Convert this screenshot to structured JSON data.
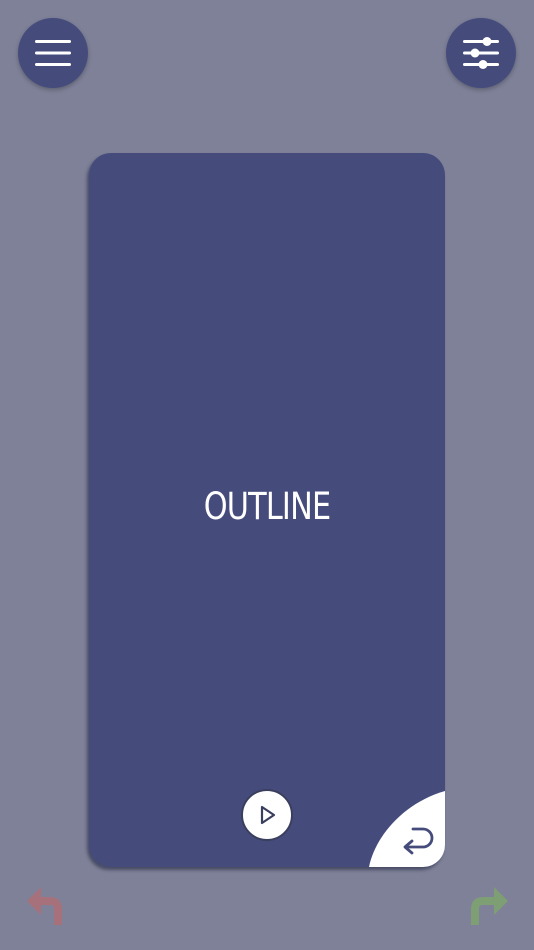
{
  "card": {
    "word": "OUTLINE"
  },
  "icons": {
    "menu": "hamburger-menu-icon",
    "filter": "sliders-icon",
    "play": "play-icon",
    "flip": "return-arrow-icon",
    "undo": "undo-arrow-icon",
    "redo": "redo-arrow-icon"
  },
  "colors": {
    "background": "#7e8198",
    "card": "#454c7c",
    "undo": "#a6717b",
    "redo": "#7e9e74"
  }
}
